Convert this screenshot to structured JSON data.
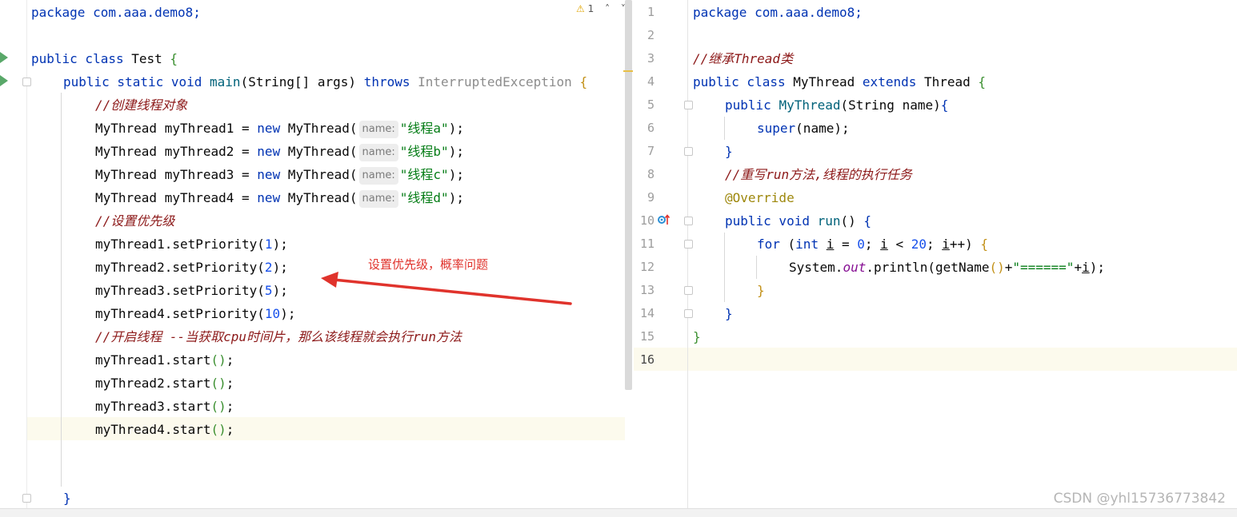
{
  "left_editor": {
    "inspection": {
      "warning_icon": "warning-triangle-icon",
      "count": "1",
      "up": "^",
      "down": "v"
    },
    "lines": {
      "l1": "package com.aaa.demo8;",
      "l3_kw": "public class",
      "l3_name": "Test",
      "l3_br": "{",
      "l4_kw": "public static void",
      "l4_fn": "main",
      "l4_sig": "(String[] args)",
      "l4_throws": "throws",
      "l4_exc": "InterruptedException",
      "l4_br": "{",
      "c1": "//创建线程对象",
      "t1_a": "MyThread myThread1 = ",
      "t1_new": "new",
      "t1_b": " MyThread(",
      "t1_hint": "name:",
      "t1_str": "\"线程a\"",
      "t1_end": ");",
      "t2_a": "MyThread myThread2 = ",
      "t2_new": "new",
      "t2_b": " MyThread(",
      "t2_hint": "name:",
      "t2_str": "\"线程b\"",
      "t2_end": ");",
      "t3_a": "MyThread myThread3 = ",
      "t3_new": "new",
      "t3_b": " MyThread(",
      "t3_hint": "name:",
      "t3_str": "\"线程c\"",
      "t3_end": ");",
      "t4_a": "MyThread myThread4 = ",
      "t4_new": "new",
      "t4_b": " MyThread(",
      "t4_hint": "name:",
      "t4_str": "\"线程d\"",
      "t4_end": ");",
      "c2": "//设置优先级",
      "p1_a": "myThread1.setPriority(",
      "p1_n": "1",
      "p1_e": ");",
      "p2_a": "myThread2.setPriority(",
      "p2_n": "2",
      "p2_e": ");",
      "p3_a": "myThread3.setPriority(",
      "p3_n": "5",
      "p3_e": ");",
      "p4_a": "myThread4.setPriority(",
      "p4_n": "10",
      "p4_e": ");",
      "c3": "//开启线程 --当获取cpu时间片，那么该线程就会执行run方法",
      "s1": "myThread1.start",
      "s2": "myThread2.start",
      "s3": "myThread3.start",
      "s4": "myThread4.start",
      "paren": "()",
      "semi": ";",
      "close": "}"
    }
  },
  "right_editor": {
    "line_numbers": [
      "1",
      "2",
      "3",
      "4",
      "5",
      "6",
      "7",
      "8",
      "9",
      "10",
      "11",
      "12",
      "13",
      "14",
      "15",
      "16"
    ],
    "lines": {
      "l1": "package com.aaa.demo8;",
      "l3": "//继承Thread类",
      "l4_kw": "public class",
      "l4_name": " MyThread ",
      "l4_ext": "extends",
      "l4_sup": " Thread ",
      "l4_br": "{",
      "l5_kw": "public",
      "l5_fn": "MyThread",
      "l5_sig": "(String name)",
      "l5_br": "{",
      "l6_kw": "super",
      "l6_rest": "(name);",
      "l7": "}",
      "l8": "//重写run方法,线程的执行任务",
      "l9": "@Override",
      "l10_kw": "public void",
      "l10_fn": "run",
      "l10_p": "()",
      "l10_br": "{",
      "l11_for": "for",
      "l11_p1": " (",
      "l11_int": "int",
      "l11_i1": "i",
      "l11_eq": " = ",
      "l11_zero": "0",
      "l11_semi1": "; ",
      "l11_i2": "i",
      "l11_lt": " < ",
      "l11_twenty": "20",
      "l11_semi2": "; ",
      "l11_i3": "i",
      "l11_pp": "++) ",
      "l11_br": "{",
      "l12_a": "System.",
      "l12_out": "out",
      "l12_b": ".println(getName",
      "l12_p": "()",
      "l12_plus": "+",
      "l12_str": "\"======\"",
      "l12_plus2": "+",
      "l12_i": "i",
      "l12_end": ");",
      "l13": "}",
      "l14": "}",
      "l15": "}"
    }
  },
  "annotation": {
    "text": "设置优先级，概率问题",
    "color": "#e0332c"
  },
  "watermark": "CSDN @yhl15736773842"
}
